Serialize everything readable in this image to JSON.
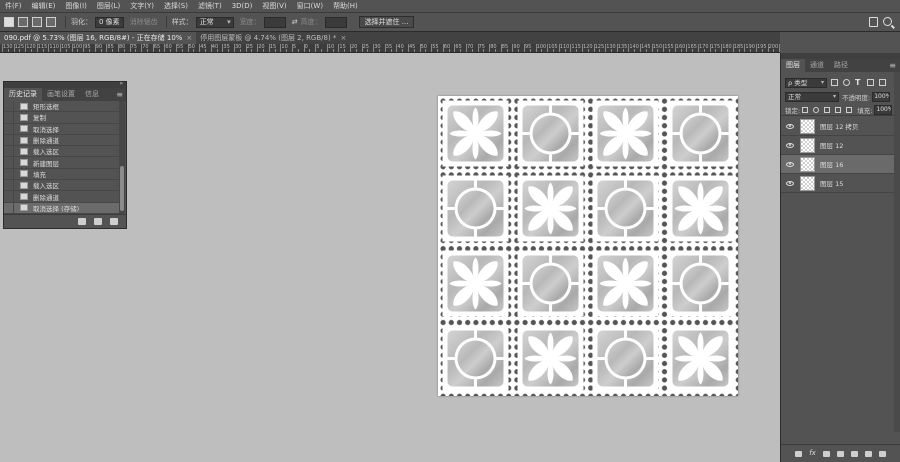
{
  "menu": [
    "件(F)",
    "编辑(E)",
    "图像(I)",
    "图层(L)",
    "文字(Y)",
    "选择(S)",
    "滤镜(T)",
    "3D(D)",
    "视图(V)",
    "窗口(W)",
    "帮助(H)"
  ],
  "options": {
    "feather_label": "羽化：",
    "feather_value": "0 像素",
    "antialias_label": "消除锯齿",
    "style_label": "样式：",
    "style_value": "正常",
    "width_label": "宽度：",
    "height_label": "高度：",
    "select_mask_button": "选择并遮住 ..."
  },
  "tabs": [
    {
      "label": "090.pdf @ 5.73% (图层 16, RGB/8#) - 正在存储 10%",
      "close": "×"
    },
    {
      "label": "停用图层蒙板 @ 4.74% (图层 2, RGB/8) *",
      "close": "×"
    }
  ],
  "ruler": [
    "130",
    "125",
    "120",
    "115",
    "110",
    "105",
    "100",
    "95",
    "90",
    "85",
    "80",
    "75",
    "70",
    "65",
    "60",
    "55",
    "50",
    "45",
    "40",
    "35",
    "30",
    "25",
    "20",
    "15",
    "10",
    "5",
    "0",
    "5",
    "10",
    "15",
    "20",
    "25",
    "30",
    "35",
    "40",
    "45",
    "50",
    "55",
    "60",
    "65",
    "70",
    "75",
    "80",
    "85",
    "90",
    "95",
    "100",
    "105",
    "110",
    "115",
    "120",
    "125",
    "130",
    "135",
    "140",
    "145",
    "150",
    "155",
    "160",
    "165",
    "170",
    "175",
    "180",
    "185",
    "190",
    "195",
    "200",
    "205",
    "210"
  ],
  "history_panel": {
    "collapse": "»",
    "menu": "≡",
    "tabs": [
      "历史记录",
      "画笔设置",
      "信息"
    ],
    "items": [
      "矩形选框",
      "复制",
      "取消选择",
      "删除通道",
      "载入选区",
      "新建图层",
      "填充",
      "载入选区",
      "删除通道",
      "取消选择 (存储)"
    ],
    "selected_index": 9
  },
  "layers_panel": {
    "tabs": [
      "图层",
      "通道",
      "路径"
    ],
    "menu": "≡",
    "filter": "ρ 类型",
    "blend": "正常",
    "opacity_label": "不透明度:",
    "opacity_value": "100%",
    "lock_label": "锁定:",
    "fill_label": "填充:",
    "fill_value": "100%",
    "layers": [
      {
        "name": "图层 12 拷贝",
        "selected": false
      },
      {
        "name": "图层 12",
        "selected": false
      },
      {
        "name": "图层 16",
        "selected": true
      },
      {
        "name": "图层 15",
        "selected": false
      }
    ],
    "bottom_fx": "fx"
  }
}
